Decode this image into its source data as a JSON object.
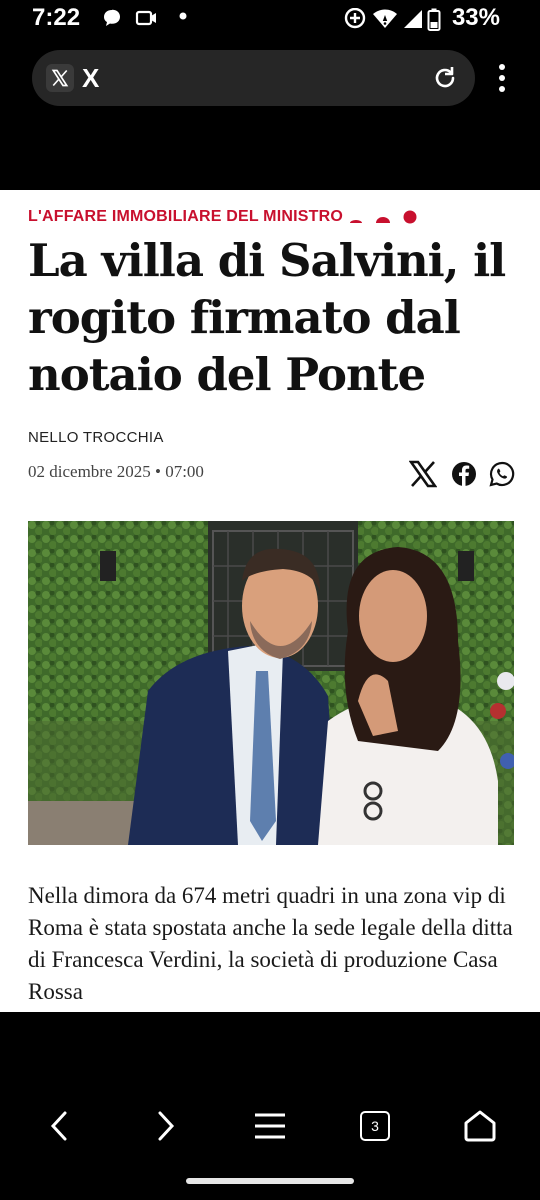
{
  "status_bar": {
    "time": "7:22",
    "battery": "33%",
    "icons": [
      "chat-bubble-icon",
      "video-icon",
      "dot-icon",
      "data-saver-icon",
      "wifi-icon",
      "signal-icon",
      "battery-icon"
    ]
  },
  "browser": {
    "url_title": "X",
    "site_icon": "x-logo-icon",
    "reload_icon": "reload-icon",
    "menu_icon": "kebab-menu-icon"
  },
  "article": {
    "kicker": "L'AFFARE IMMOBILIARE DEL MINISTRO",
    "headline": "La villa di Salvini, il rogito firmato dal notaio del Ponte",
    "author": "NELLO TROCCHIA",
    "date": "02 dicembre 2025 • 07:00",
    "share_icons": [
      "x-share-icon",
      "facebook-share-icon",
      "whatsapp-share-icon"
    ],
    "lead": "Nella dimora da 674 metri quadri in una zona vip di Roma è stata spostata anche la sede legale della ditta di Francesca Verdini, la società di produzione Casa Rossa",
    "accent_color": "#c8102e"
  },
  "nav": {
    "tab_count": "3",
    "buttons": [
      "back-icon",
      "forward-icon",
      "hamburger-menu-icon",
      "tabs-icon",
      "home-icon"
    ]
  }
}
